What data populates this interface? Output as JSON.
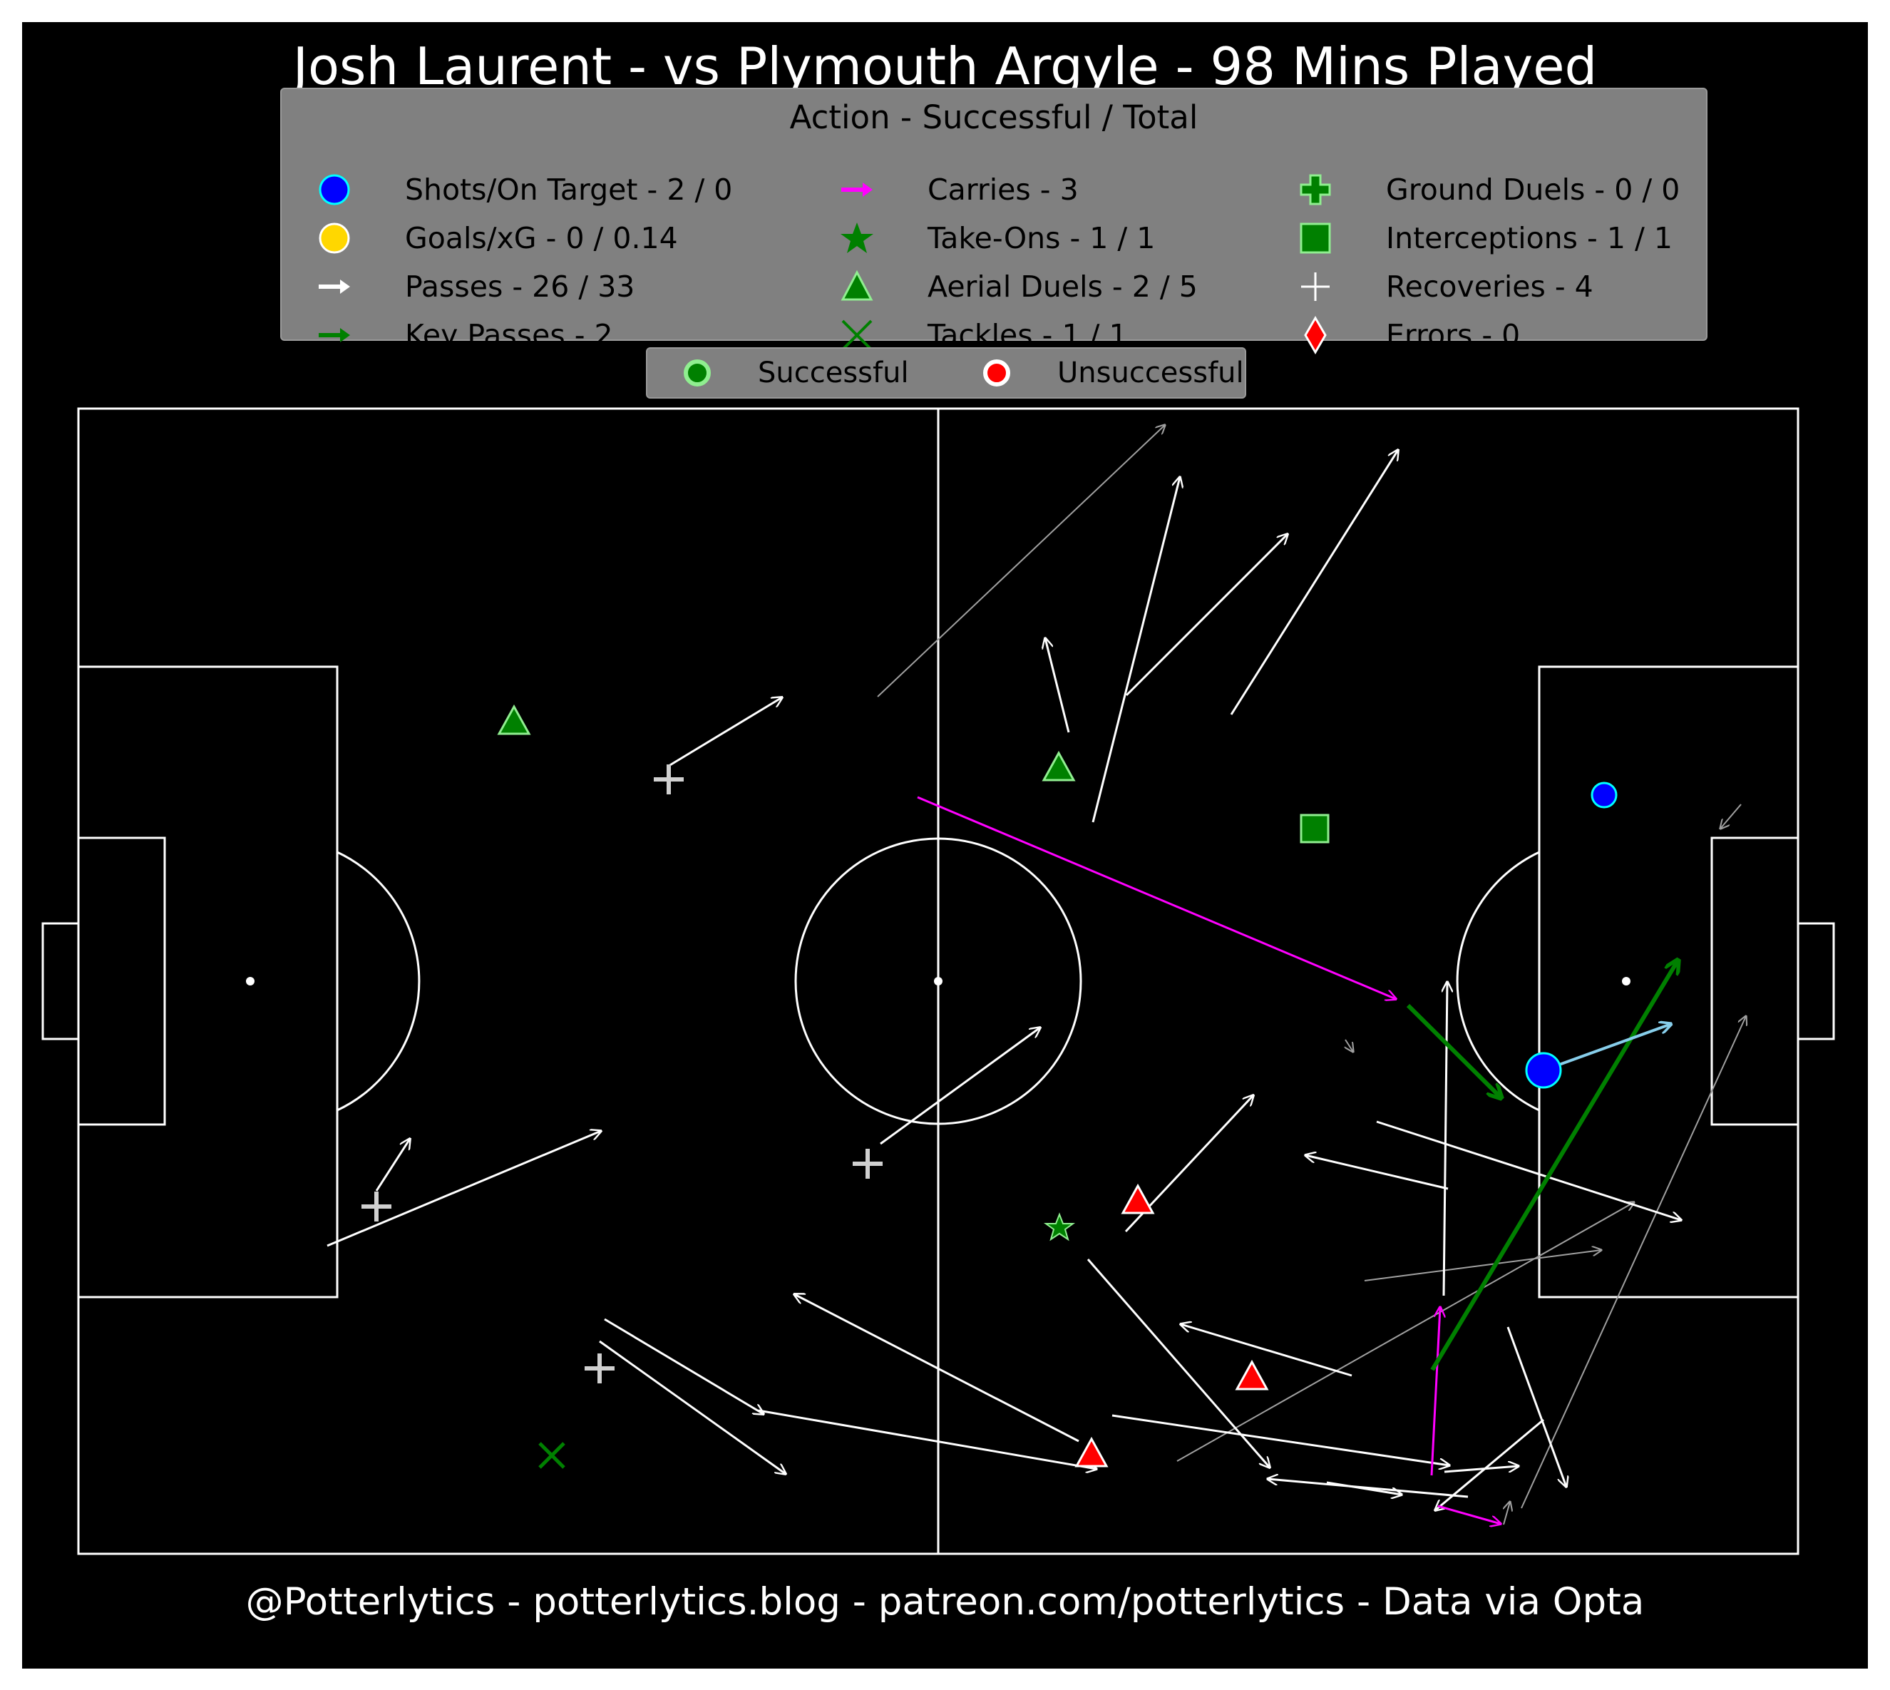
{
  "title": "Josh Laurent - vs Plymouth Argyle - 98 Mins Played",
  "footer": "@Potterlytics - potterlytics.blog - patreon.com/potterlytics - Data via Opta",
  "legend": {
    "title": "Action - Successful / Total",
    "items": [
      {
        "label": "Shots/On Target - 2 / 0",
        "icon": "blue-circle",
        "color": "#0000ff"
      },
      {
        "label": "Goals/xG - 0 / 0.14",
        "icon": "gold-circle",
        "color": "#ffd700"
      },
      {
        "label": "Passes - 26 / 33",
        "icon": "white-arrow",
        "color": "#ffffff"
      },
      {
        "label": "Key Passes - 2",
        "icon": "green-arrow",
        "color": "#008000"
      },
      {
        "label": "Carries - 3",
        "icon": "magenta-arrow",
        "color": "#ff00ff"
      },
      {
        "label": "Take-Ons - 1 / 1",
        "icon": "green-star",
        "color": "#008000"
      },
      {
        "label": "Aerial Duels - 2 / 5",
        "icon": "green-triangle",
        "color": "#008000"
      },
      {
        "label": "Tackles - 1 / 1",
        "icon": "green-x",
        "color": "#008000"
      },
      {
        "label": "Ground Duels - 0 / 0",
        "icon": "green-plus",
        "color": "#008000"
      },
      {
        "label": "Interceptions - 1 / 1",
        "icon": "green-square",
        "color": "#008000"
      },
      {
        "label": "Recoveries - 4",
        "icon": "white-cross",
        "color": "#ffffff"
      },
      {
        "label": "Errors - 0",
        "icon": "red-diamond",
        "color": "#ff0000"
      }
    ]
  },
  "outcome_legend": {
    "successful": "Successful",
    "unsuccessful": "Unsuccessful",
    "successful_color": "#90ee90",
    "unsuccessful_color": "#ff0000"
  }
}
